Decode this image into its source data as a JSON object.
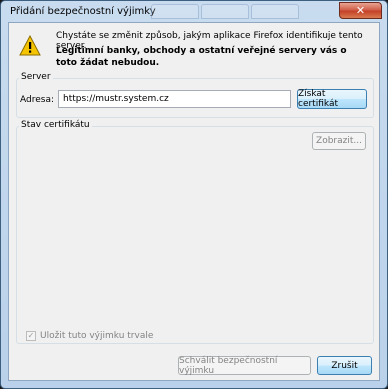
{
  "window": {
    "title": "Přidání bezpečnostní výjimky",
    "close_glyph": "✕"
  },
  "message": {
    "line1": "Chystáte se změnit způsob, jakým aplikace Firefox identifikuje tento server.",
    "line2": "Legitimní banky, obchody a ostatní veřejné servery vás o toto žádat nebudou."
  },
  "server": {
    "group_label": "Server",
    "address_label": "Adresa:",
    "address_value": "https://mustr.system.cz",
    "get_cert_label": "Získat certifikát"
  },
  "cert_status": {
    "group_label": "Stav certifikátu",
    "view_label": "Zobrazit..."
  },
  "footer": {
    "permanent_label": "Uložit tuto výjimku trvale",
    "permanent_checked": true,
    "confirm_label": "Schválit bezpečnostní výjimku",
    "cancel_label": "Zrušit"
  },
  "colors": {
    "warning_fill": "#f5c400",
    "frame": "#b9d1ea",
    "close": "#c44128"
  },
  "icons": {
    "warning": "warning-icon",
    "close": "close-icon",
    "check": "checkmark-icon"
  }
}
